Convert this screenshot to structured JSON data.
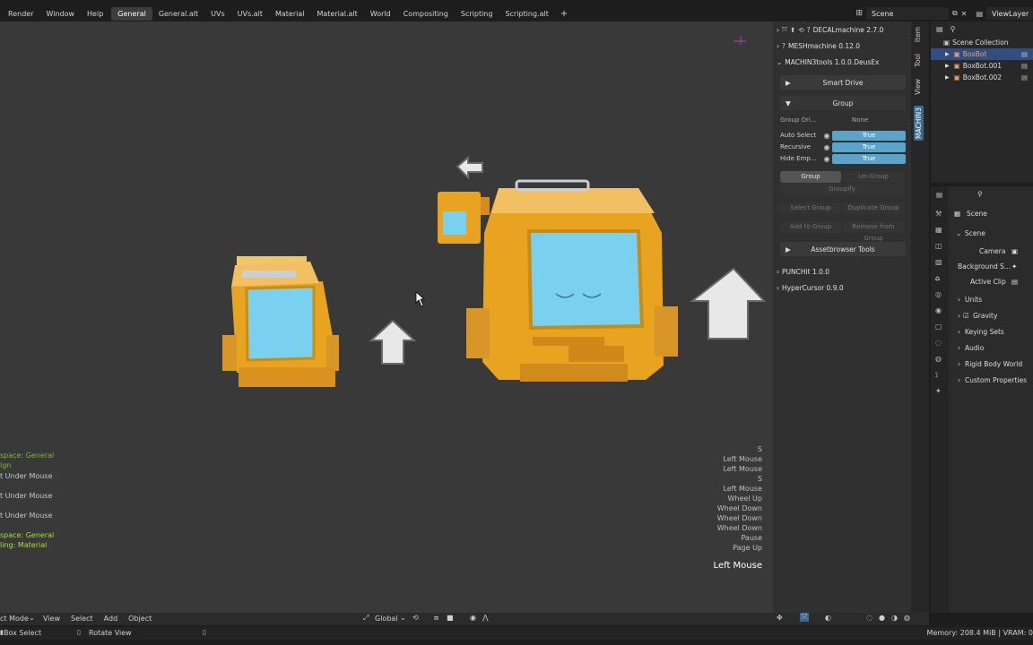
{
  "menu": [
    "Render",
    "Window",
    "Help"
  ],
  "workspace_tabs": [
    {
      "label": "General",
      "active": true
    },
    {
      "label": "General.alt",
      "active": false
    },
    {
      "label": "UVs",
      "active": false
    },
    {
      "label": "UVs.alt",
      "active": false
    },
    {
      "label": "Material",
      "active": false
    },
    {
      "label": "Material.alt",
      "active": false
    },
    {
      "label": "World",
      "active": false
    },
    {
      "label": "Compositing",
      "active": false
    },
    {
      "label": "Scripting",
      "active": false
    },
    {
      "label": "Scripting.alt",
      "active": false
    }
  ],
  "add_tab": "+",
  "scene_name": "Scene",
  "view_layer": "ViewLayer",
  "left_log": [
    {
      "text": "space: General",
      "color": "#7dbb2e"
    },
    {
      "text": "ign",
      "color": "#7dbb2e"
    },
    {
      "text": "t Under Mouse",
      "color": "#c8c8c8"
    },
    {
      "text": "t Under Mouse",
      "color": "#c8c8c8"
    },
    {
      "text": "t Under Mouse",
      "color": "#c8c8c8"
    },
    {
      "text": "space: General",
      "color": "#a6e22e"
    },
    {
      "text": "ling: Material",
      "color": "#a6e22e"
    }
  ],
  "key_log": [
    "S",
    "Left Mouse",
    "Left Mouse",
    "S",
    "Left Mouse",
    "Wheel Up",
    "Wheel Down",
    "Wheel Down",
    "Wheel Down",
    "Pause",
    "Page Up"
  ],
  "key_last": "Left Mouse",
  "npanel": {
    "addons": [
      {
        "label": "DECALmachine 2.7.0",
        "open": false
      },
      {
        "label": "MESHmachine 0.12.0",
        "open": false
      },
      {
        "label": "MACHIN3tools 1.0.0.DeusEx",
        "open": true
      }
    ],
    "smart_drive": "Smart Drive",
    "group_header": "Group",
    "group_origin_label": "Group Ori...",
    "group_origin_value": "None",
    "props": [
      {
        "label": "Auto Select",
        "value": "True"
      },
      {
        "label": "Recursive",
        "value": "True"
      },
      {
        "label": "Hide Emp...",
        "value": "True"
      }
    ],
    "buttons": {
      "group": "Group",
      "ungroup": "Un-Group",
      "groupify": "Groupify",
      "select_group": "Select Group",
      "duplicate_group": "Duplicate Group",
      "add_to_group": "Add to Group",
      "remove_from_group": "Remove from Group"
    },
    "assetbrowser": "Assetbrowser Tools",
    "punchit": "PUNCHit 1.0.0",
    "hypercursor": "HyperCursor 0.9.0"
  },
  "ntabs": [
    "Item",
    "Tool",
    "View",
    "MACHIN3"
  ],
  "outliner": {
    "collection": "Scene Collection",
    "items": [
      {
        "label": "BoxBot",
        "selected": true
      },
      {
        "label": "BoxBot.001",
        "selected": false
      },
      {
        "label": "BoxBot.002",
        "selected": false
      }
    ]
  },
  "properties": {
    "breadcrumb": "Scene",
    "section": "Scene",
    "camera_label": "Camera",
    "bg_label": "Background S...",
    "clip_label": "Active Clip",
    "panels": [
      "Units",
      "Gravity",
      "Keying Sets",
      "Audio",
      "Rigid Body World",
      "Custom Properties"
    ],
    "gravity_checked": true
  },
  "bottombar": {
    "mode": "ct Mode",
    "menus": [
      "View",
      "Select",
      "Add",
      "Object"
    ],
    "transform": "Global"
  },
  "status": {
    "left": "Box Select",
    "middle": "Rotate View",
    "right": "Memory: 208.4 MiB | VRAM: 0"
  },
  "colors": {
    "viewport_bg": "#393939",
    "robot_yellow": "#e8a421",
    "robot_screen": "#6cc0e6",
    "prop_blue": "#5aa3c9",
    "selection_blue": "#334d80"
  }
}
